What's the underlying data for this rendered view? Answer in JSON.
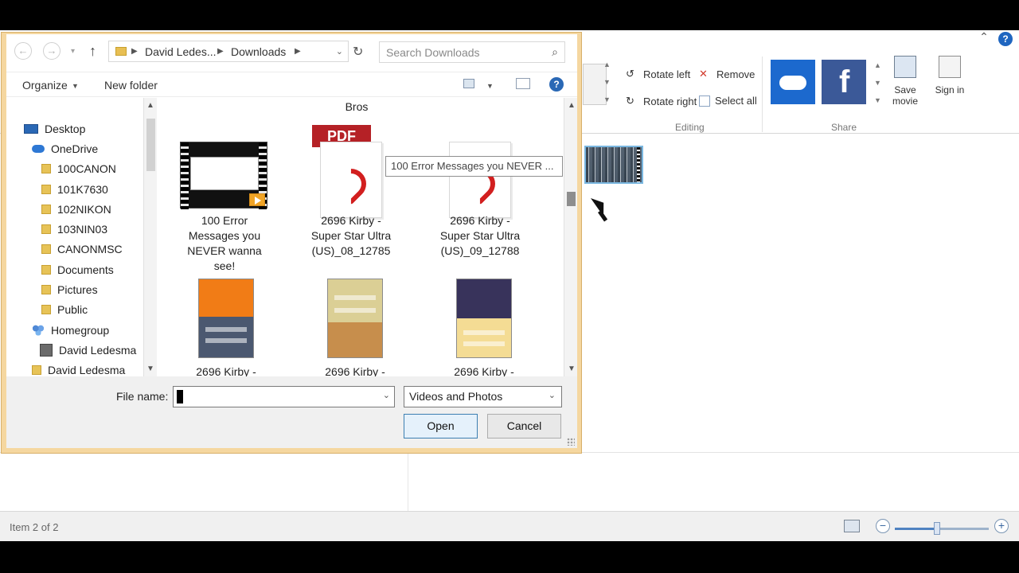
{
  "app": {
    "ribbon": {
      "rotate_left": "Rotate left",
      "rotate_right": "Rotate right",
      "remove": "Remove",
      "select_all": "Select all",
      "editing": "Editing",
      "share": "Share",
      "save_movie": "Save movie",
      "sign_in": "Sign in",
      "help": "?"
    },
    "status": {
      "item_text": "Item 2 of 2",
      "zoom_level": 0.45
    }
  },
  "dialog": {
    "address": {
      "parent": "David Ledes...",
      "current": "Downloads"
    },
    "search_placeholder": "Search Downloads",
    "toolbar": {
      "organize": "Organize",
      "new_folder": "New folder",
      "help": "?"
    },
    "nav_tree": [
      {
        "label": "Desktop"
      },
      {
        "label": "OneDrive"
      },
      {
        "label": "100CANON"
      },
      {
        "label": "101K7630"
      },
      {
        "label": "102NIKON"
      },
      {
        "label": "103NIN03"
      },
      {
        "label": "CANONMSC"
      },
      {
        "label": "Documents"
      },
      {
        "label": "Pictures"
      },
      {
        "label": "Public"
      },
      {
        "label": "Homegroup"
      },
      {
        "label": "David Ledesma"
      },
      {
        "label": "David Ledesma"
      }
    ],
    "files": {
      "partial_top": "Bros",
      "tooltip": "100 Error Messages you NEVER ...",
      "pdf_badge": "PDF",
      "items": [
        {
          "label": "100 Error Messages you NEVER wanna see!"
        },
        {
          "label": "2696 Kirby - Super Star Ultra (US)_08_12785"
        },
        {
          "label": "2696 Kirby - Super Star Ultra (US)_09_12788"
        },
        {
          "label": "2696 Kirby -"
        },
        {
          "label": "2696 Kirby -"
        },
        {
          "label": "2696 Kirby -"
        }
      ]
    },
    "bottom": {
      "file_name_label": "File name:",
      "file_name_value": "",
      "file_type": "Videos and Photos",
      "open": "Open",
      "cancel": "Cancel"
    }
  }
}
